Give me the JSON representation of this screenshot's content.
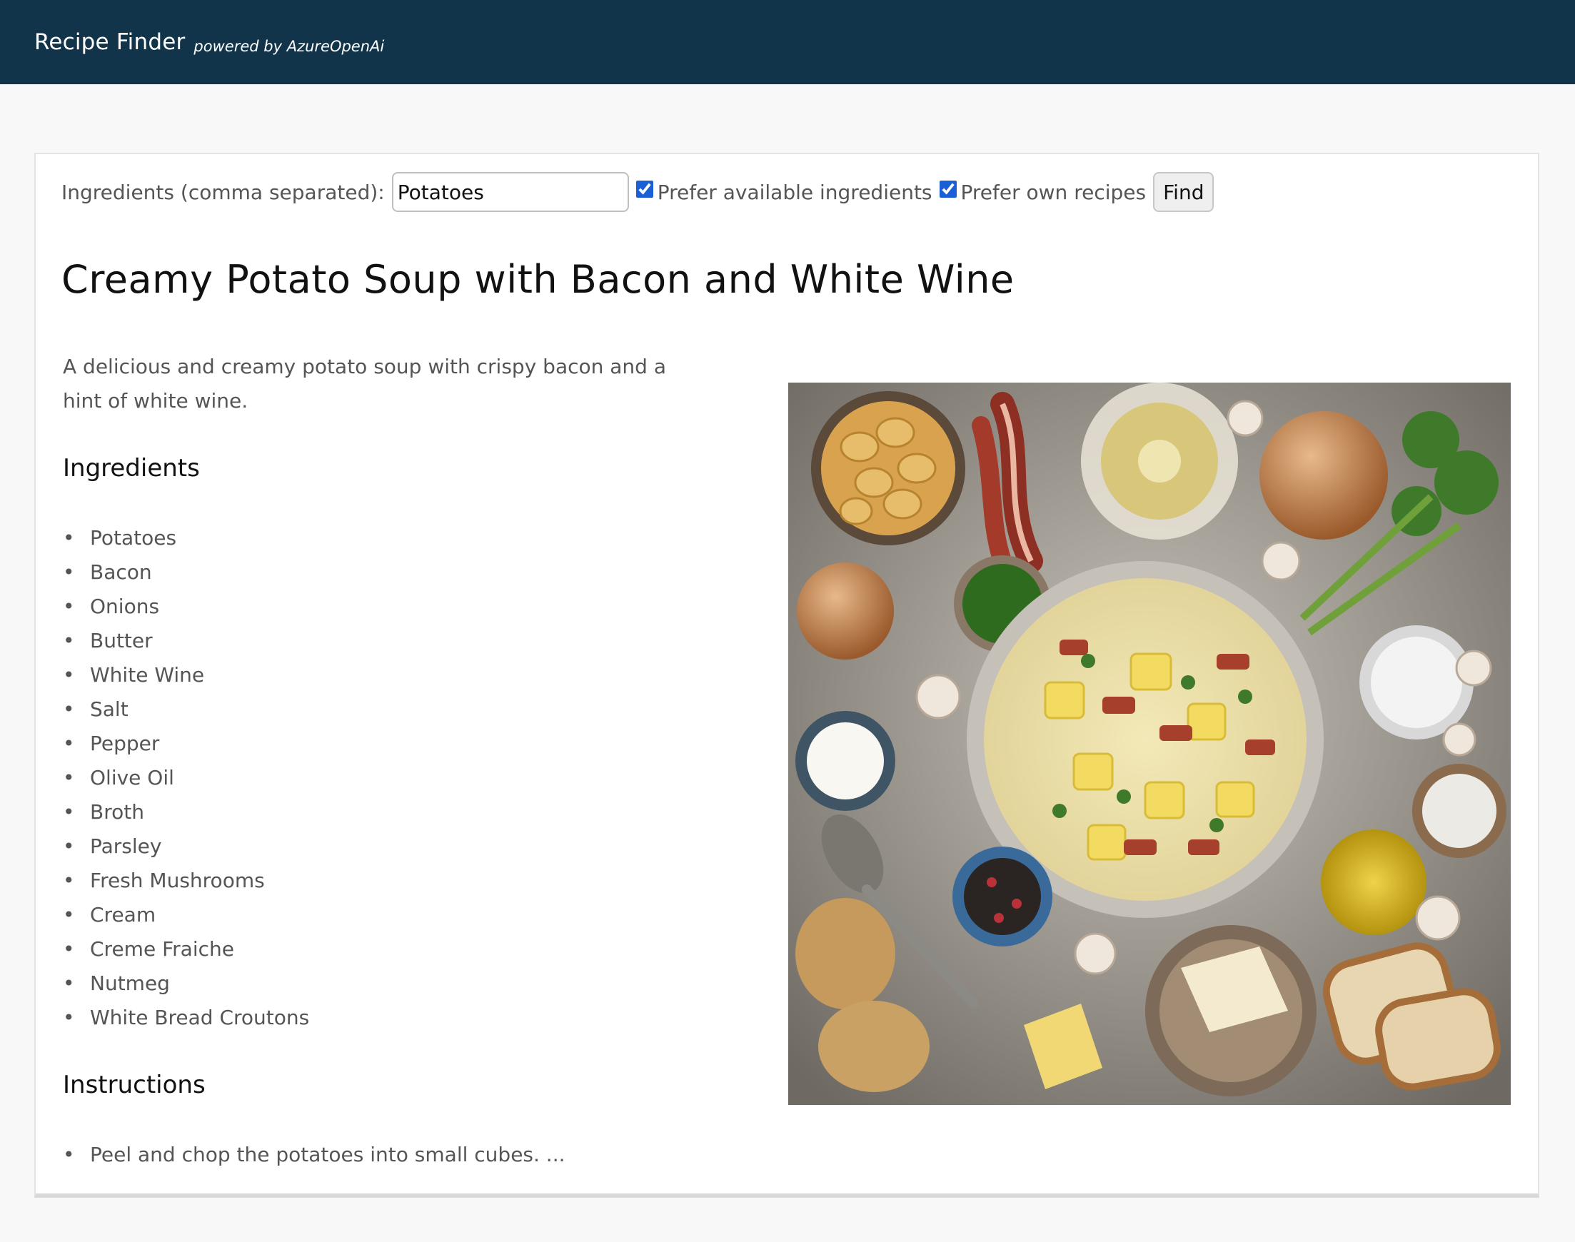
{
  "header": {
    "brand": "Recipe Finder",
    "powered_by": "powered by AzureOpenAi",
    "background_color": "#12344b"
  },
  "search": {
    "label": "Ingredients (comma separated):",
    "value": "Potatoes",
    "prefer_available": {
      "label": "Prefer available ingredients",
      "checked": true
    },
    "prefer_own": {
      "label": "Prefer own recipes",
      "checked": true
    },
    "find_label": "Find"
  },
  "recipe": {
    "title": "Creamy Potato Soup with Bacon and White Wine",
    "description": "A delicious and creamy potato soup with crispy bacon and a hint of white wine.",
    "ingredients_heading": "Ingredients",
    "ingredients": [
      "Potatoes",
      "Bacon",
      "Onions",
      "Butter",
      "White Wine",
      "Salt",
      "Pepper",
      "Olive Oil",
      "Broth",
      "Parsley",
      "Fresh Mushrooms",
      "Cream",
      "Creme Fraiche",
      "Nutmeg",
      "White Bread Croutons"
    ],
    "instructions_heading": "Instructions",
    "instructions": [
      "Peel and chop the potatoes into small cubes. ..."
    ]
  }
}
